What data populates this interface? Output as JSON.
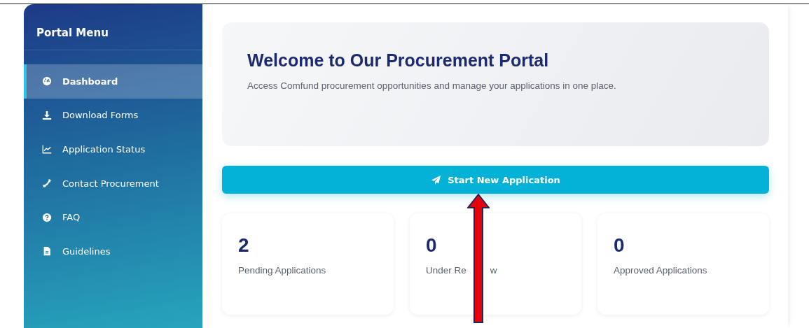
{
  "sidebar": {
    "title": "Portal Menu",
    "items": [
      {
        "label": "Dashboard",
        "selected": true
      },
      {
        "label": "Download Forms",
        "selected": false
      },
      {
        "label": "Application Status",
        "selected": false
      },
      {
        "label": "Contact Procurement",
        "selected": false
      },
      {
        "label": "FAQ",
        "selected": false
      },
      {
        "label": "Guidelines",
        "selected": false
      }
    ]
  },
  "welcome": {
    "title": "Welcome to Our Procurement Portal",
    "text": "Access Comfund procurement opportunities and manage your applications in one place."
  },
  "start_button": "Start New Application",
  "stats": [
    {
      "value": "2",
      "label": "Pending Applications"
    },
    {
      "value": "0",
      "label": "Under Re",
      "label_after_arrow": "w"
    },
    {
      "value": "0",
      "label": "Approved Applications"
    }
  ]
}
